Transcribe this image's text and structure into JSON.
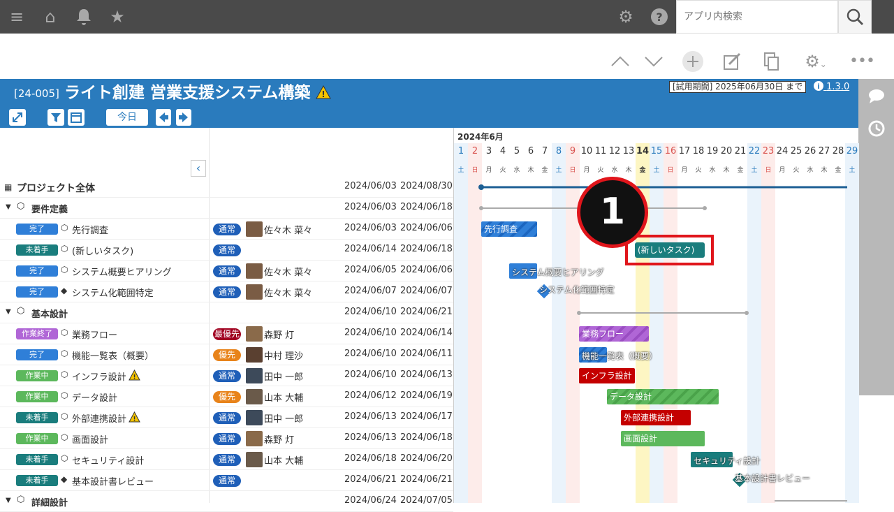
{
  "search": {
    "placeholder": "アプリ内検索"
  },
  "project": {
    "code": "[24-005]",
    "title": "ライト創建 営業支援システム構築",
    "trial": "[試用期間] 2025年06月30日 まで",
    "version": "1.3.0",
    "today_label": "今日"
  },
  "gantt": {
    "month": "2024年6月",
    "days": [
      "1",
      "2",
      "3",
      "4",
      "5",
      "6",
      "7",
      "8",
      "9",
      "10",
      "11",
      "12",
      "13",
      "14",
      "15",
      "16",
      "17",
      "18",
      "19",
      "20",
      "21",
      "22",
      "23",
      "24",
      "25",
      "26",
      "27",
      "28",
      "29"
    ],
    "weekdays": [
      "土",
      "日",
      "月",
      "火",
      "水",
      "木",
      "金",
      "土",
      "日",
      "月",
      "火",
      "水",
      "木",
      "金",
      "土",
      "日",
      "月",
      "火",
      "水",
      "木",
      "金",
      "土",
      "日",
      "月",
      "火",
      "水",
      "木",
      "金",
      "土"
    ]
  },
  "rows": [
    {
      "name": "プロジェクト全体",
      "start": "2024/06/03",
      "end": "2024/08/30"
    },
    {
      "name": "要件定義",
      "start": "2024/06/03",
      "end": "2024/06/18"
    },
    {
      "status": "完了",
      "name": "先行調査",
      "priority": "通常",
      "assignee": "佐々木 菜々",
      "start": "2024/06/03",
      "end": "2024/06/06"
    },
    {
      "status": "未着手",
      "name": "(新しいタスク)",
      "priority": "通常",
      "assignee": "",
      "start": "2024/06/14",
      "end": "2024/06/18"
    },
    {
      "status": "完了",
      "name": "システム概要ヒアリング",
      "priority": "通常",
      "assignee": "佐々木 菜々",
      "start": "2024/06/05",
      "end": "2024/06/06"
    },
    {
      "status": "完了",
      "name": "システム化範囲特定",
      "priority": "通常",
      "assignee": "佐々木 菜々",
      "start": "2024/06/07",
      "end": "2024/06/07"
    },
    {
      "name": "基本設計",
      "start": "2024/06/10",
      "end": "2024/06/21"
    },
    {
      "status": "作業終了",
      "name": "業務フロー",
      "priority": "最優先",
      "assignee": "森野 灯",
      "start": "2024/06/10",
      "end": "2024/06/14"
    },
    {
      "status": "完了",
      "name": "機能一覧表（概要）",
      "priority": "優先",
      "assignee": "中村 理沙",
      "start": "2024/06/10",
      "end": "2024/06/11"
    },
    {
      "status": "作業中",
      "name": "インフラ設計",
      "priority": "通常",
      "assignee": "田中 一郎",
      "start": "2024/06/10",
      "end": "2024/06/13"
    },
    {
      "status": "作業中",
      "name": "データ設計",
      "priority": "優先",
      "assignee": "山本 大輔",
      "start": "2024/06/12",
      "end": "2024/06/19"
    },
    {
      "status": "未着手",
      "name": "外部連携設計",
      "priority": "通常",
      "assignee": "田中 一郎",
      "start": "2024/06/13",
      "end": "2024/06/17"
    },
    {
      "status": "作業中",
      "name": "画面設計",
      "priority": "通常",
      "assignee": "森野 灯",
      "start": "2024/06/13",
      "end": "2024/06/18"
    },
    {
      "status": "未着手",
      "name": "セキュリティ設計",
      "priority": "通常",
      "assignee": "山本 大輔",
      "start": "2024/06/18",
      "end": "2024/06/20"
    },
    {
      "status": "未着手",
      "name": "基本設計書レビュー",
      "priority": "通常",
      "assignee": "",
      "start": "2024/06/21",
      "end": "2024/06/21"
    },
    {
      "name": "詳細設計",
      "start": "2024/06/24",
      "end": "2024/07/05"
    }
  ],
  "bars": {
    "b0": "先行調査",
    "b1": "(新しいタスク)",
    "b2": "システム概要ヒアリング",
    "b3": "システム化範囲特定",
    "b4": "業務フロー",
    "b5": "機能一覧表（概要）",
    "b6": "インフラ設計",
    "b7": "データ設計",
    "b8": "外部連携設計",
    "b9": "画面設計",
    "b10": "セキュリティ設計",
    "b11": "基本設計書レビュー"
  },
  "callout_number": "1",
  "colors": {
    "header": "#2a7bbd",
    "done": "#2f7fd8",
    "not_started": "#1a7d7d",
    "in_progress": "#5cb85c",
    "finished": "#b066d6",
    "critical": "#c40000",
    "highlight": "#e0151b"
  }
}
